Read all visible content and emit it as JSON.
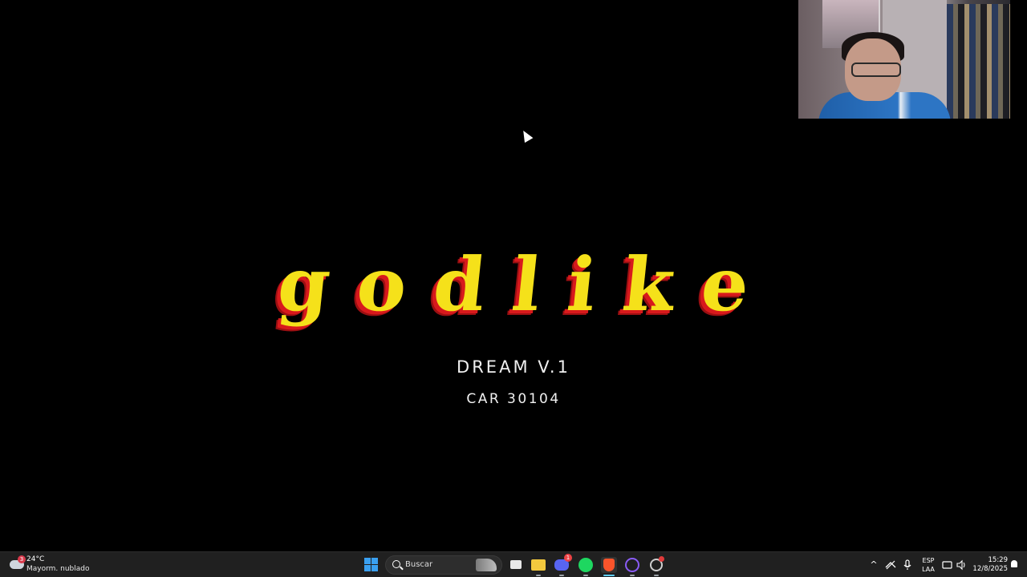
{
  "stage": {
    "title": "godlike",
    "subtitle": "DREAM V.1",
    "code": "CAR 30104",
    "title_colors": {
      "fill": "#f5e11a",
      "shadow": "#d8191c"
    }
  },
  "taskbar": {
    "weather": {
      "temp": "24°C",
      "desc": "Mayorm. nublado",
      "badge": "3"
    },
    "search": {
      "label": "Buscar"
    },
    "apps": [
      {
        "name": "task-view",
        "icon": "task-view-icon"
      },
      {
        "name": "file-explorer",
        "icon": "folder-icon"
      },
      {
        "name": "discord",
        "icon": "discord-icon",
        "badge": "1"
      },
      {
        "name": "spotify",
        "icon": "spotify-icon"
      },
      {
        "name": "brave",
        "icon": "brave-icon",
        "active": true
      },
      {
        "name": "obs",
        "icon": "obs-icon"
      },
      {
        "name": "extra-app",
        "icon": "circle-app-icon"
      }
    ],
    "tray": {
      "chevron": "^",
      "lang_top": "ESP",
      "lang_bottom": "LAA"
    },
    "clock": {
      "time": "15:29",
      "date": "12/8/2025"
    }
  }
}
